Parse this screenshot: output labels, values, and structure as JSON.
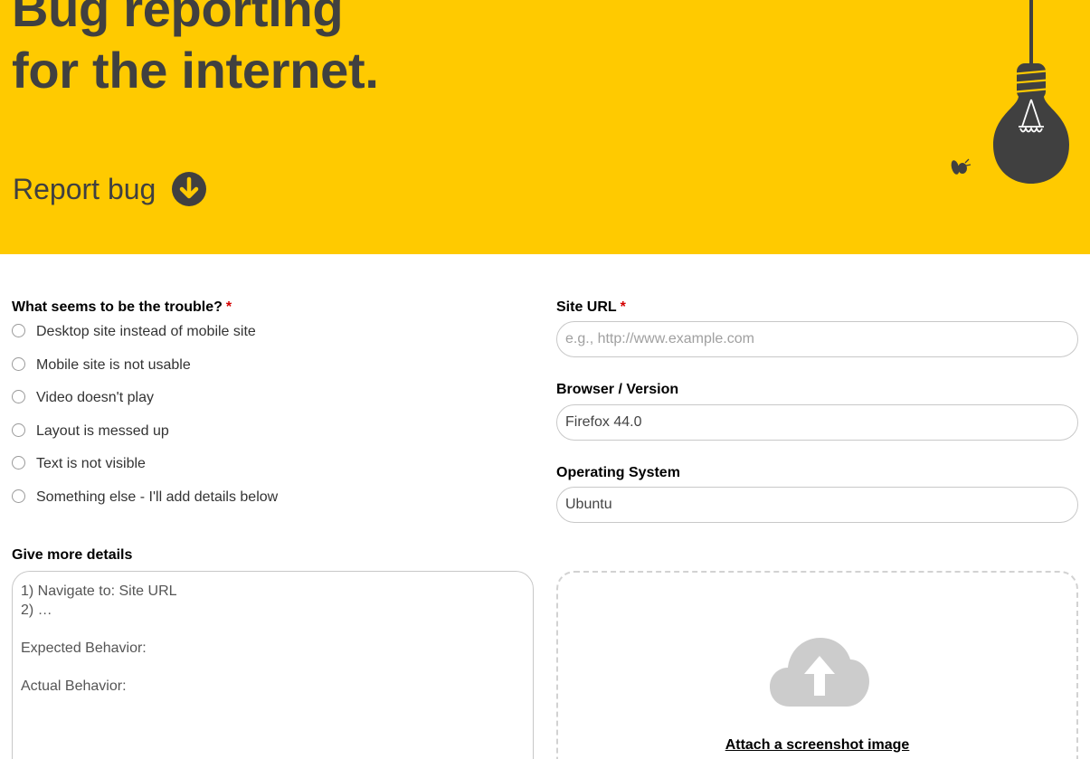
{
  "hero": {
    "title_line1": "Bug reporting",
    "title_line2": "for the internet.",
    "report_label": "Report bug",
    "background": "#ffca00",
    "text_color": "#404040"
  },
  "form": {
    "trouble": {
      "label": "What seems to be the trouble?",
      "required_mark": "*",
      "options": [
        "Desktop site instead of mobile site",
        "Mobile site is not usable",
        "Video doesn't play",
        "Layout is messed up",
        "Text is not visible",
        "Something else - I'll add details below"
      ]
    },
    "site_url": {
      "label": "Site URL",
      "required_mark": "*",
      "placeholder": "e.g., http://www.example.com"
    },
    "browser": {
      "label": "Browser / Version",
      "value": "Firefox 44.0"
    },
    "os": {
      "label": "Operating System",
      "value": "Ubuntu"
    },
    "details": {
      "label": "Give more details",
      "lines": [
        "1) Navigate to: Site URL",
        "2) …",
        "",
        "Expected Behavior:",
        "",
        "Actual Behavior:"
      ]
    },
    "attach": {
      "label": "Attach a screenshot image"
    }
  },
  "icons": {
    "report": "arrow-down-circle-icon",
    "bulb": "hanging-lightbulb-icon",
    "bug": "bug-icon",
    "upload": "cloud-upload-icon"
  }
}
